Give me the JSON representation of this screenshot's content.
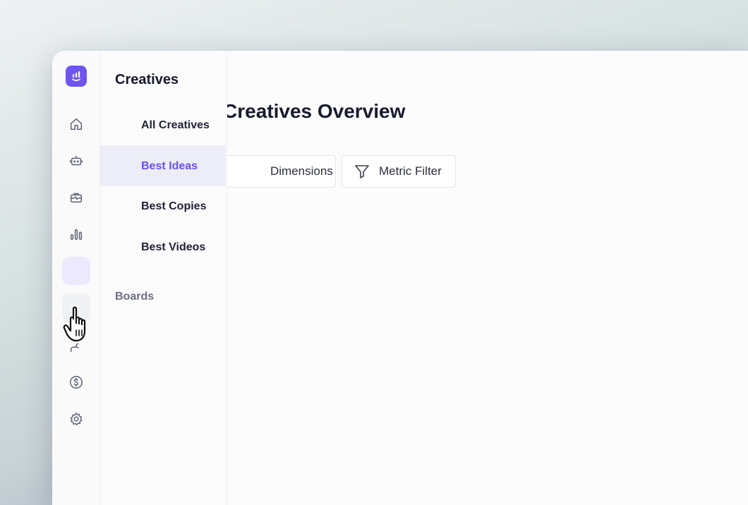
{
  "flyout": {
    "title": "Creatives",
    "items": [
      {
        "label": "All Creatives"
      },
      {
        "label": "Best Ideas"
      },
      {
        "label": "Best Copies"
      },
      {
        "label": "Best Videos"
      }
    ],
    "section_label": "Boards"
  },
  "main": {
    "page_title": "Creatives Overview",
    "filters": [
      {
        "label": "Dimensions Filter"
      },
      {
        "label": "Metric Filter",
        "icon": "funnel-icon"
      }
    ]
  },
  "rail": {
    "icons": [
      "home-icon",
      "robot-icon",
      "briefcase-icon",
      "bar-chart-icon",
      "creatives-icon",
      "users-icon",
      "dollar-icon",
      "settings-icon"
    ],
    "active": "creatives-icon"
  },
  "colors": {
    "accent": "#6f55ee",
    "active_bg": "#ecedf6"
  }
}
